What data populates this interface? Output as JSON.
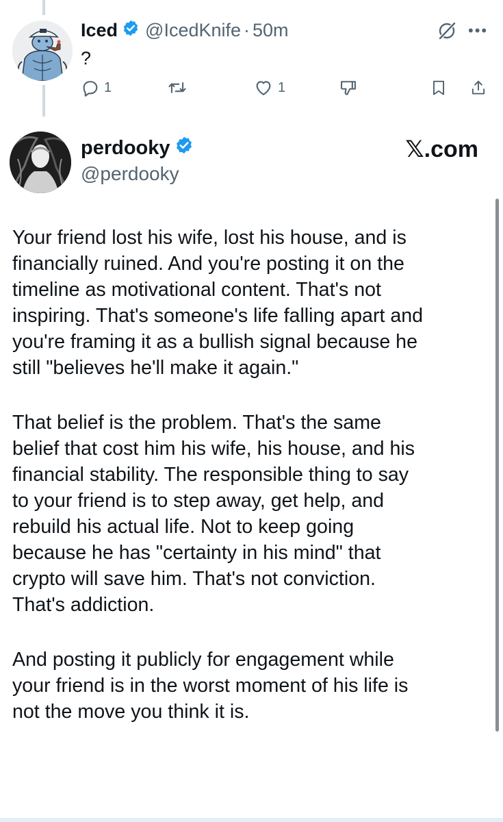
{
  "reply": {
    "name": "Iced",
    "handle": "@IcedKnife",
    "separator": "·",
    "time": "50m",
    "text": "?",
    "actions": {
      "reply_count": "1",
      "retweet_count": "",
      "like_count": "1"
    }
  },
  "post": {
    "name": "perdooky",
    "handle": "@perdooky",
    "watermark": "𝕏.com",
    "paragraphs": [
      {
        "lines": [
          "Your friend lost his wife, lost his house, and is",
          "financially ruined. And you're posting it on the",
          "timeline as motivational content. That's not",
          "inspiring. That's someone's life falling apart and",
          "you're framing it as a bullish signal because he",
          "still \"believes he'll make it again.\""
        ]
      },
      {
        "lines": [
          "That belief is the problem. That's the same",
          "belief that cost him his wife, his house, and his",
          "financial stability. The responsible thing to say",
          "to your friend is to step away, get help, and",
          "rebuild his actual life. Not to keep going",
          "because he has \"certainty in his mind\" that",
          "crypto will save him. That's not conviction.",
          "That's addiction."
        ]
      },
      {
        "lines": [
          "And posting it publicly for engagement while",
          "your friend is in the worst moment of his life is",
          "not the move you think it is."
        ]
      }
    ]
  },
  "icons": {
    "verified": "verified-badge-icon",
    "grok": "grok-icon",
    "more": "more-icon",
    "reply": "reply-icon",
    "retweet": "retweet-icon",
    "like": "heart-icon",
    "dislike": "thumbs-down-icon",
    "bookmark": "bookmark-icon",
    "share": "share-icon"
  },
  "colors": {
    "text": "#0f1419",
    "secondary": "#536471",
    "verified": "#1d9bf0",
    "thread_line": "#cfd9de"
  }
}
